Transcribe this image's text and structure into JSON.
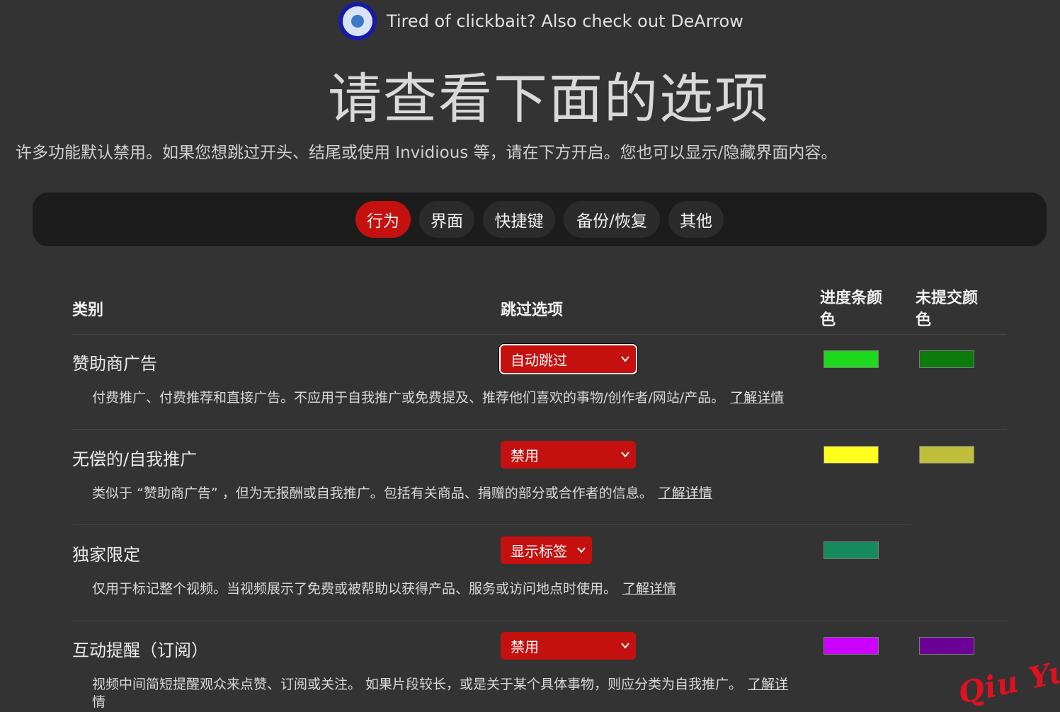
{
  "banner": {
    "text": "Tired of clickbait? Also check out DeArrow",
    "logo_icon": "dearrow-logo-icon"
  },
  "page_title": "请查看下面的选项",
  "subtitle": "许多功能默认禁用。如果您想跳过开头、结尾或使用 Invidious 等，请在下方开启。您也可以显示/隐藏界面内容。",
  "tabs": [
    {
      "label": "行为",
      "active": true
    },
    {
      "label": "界面",
      "active": false
    },
    {
      "label": "快捷键",
      "active": false
    },
    {
      "label": "备份/恢复",
      "active": false
    },
    {
      "label": "其他",
      "active": false
    }
  ],
  "table": {
    "headers": {
      "category": "类别",
      "skip_option": "跳过选项",
      "bar_color_line1": "进度条颜",
      "bar_color_line2": "色",
      "unsubmitted_color_line1": "未提交颜",
      "unsubmitted_color_line2": "色"
    },
    "rows": [
      {
        "name": "赞助商广告",
        "description": "付费推广、付费推荐和直接广告。不应用于自我推广或免费提及、推荐他们喜欢的事物/创作者/网站/产品。",
        "learn_more": "了解详情",
        "skip_option": "自动跳过",
        "bar_color": "#1ed81e",
        "unsubmitted_color": "#0b7b0b"
      },
      {
        "name": "无偿的/自我推广",
        "description": "类似于 “赞助商广告” ，但为无报酬或自我推广。包括有关商品、捐赠的部分或合作者的信息。",
        "learn_more": "了解详情",
        "skip_option": "禁用",
        "bar_color": "#ffff1e",
        "unsubmitted_color": "#bfbf3c"
      },
      {
        "name": "独家限定",
        "description": "仅用于标记整个视频。当视频展示了免费或被帮助以获得产品、服务或访问地点时使用。",
        "learn_more": "了解详情",
        "skip_option": "显示标签",
        "bar_color": "#188a5f",
        "unsubmitted_color": ""
      },
      {
        "name": "互动提醒（订阅）",
        "description": "视频中间简短提醒观众来点赞、订阅或关注。 如果片段较长，或是关于某个具体事物，则应分类为自我推广。",
        "learn_more": "了解详",
        "learn_more_wrap": "情",
        "skip_option": "禁用",
        "bar_color": "#cc00ff",
        "unsubmitted_color": "#6c0096"
      }
    ]
  },
  "watermark": "Qiu Yue"
}
